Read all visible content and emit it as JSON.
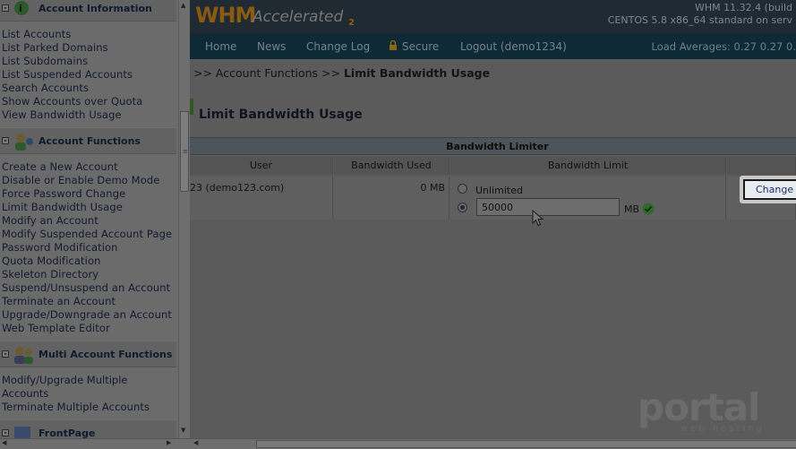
{
  "sidebar": {
    "sections": [
      {
        "title": "Account Information",
        "links": [
          "List Accounts",
          "List Parked Domains",
          "List Subdomains",
          "List Suspended Accounts",
          "Search Accounts",
          "Show Accounts over Quota",
          "View Bandwidth Usage"
        ]
      },
      {
        "title": "Account Functions",
        "links": [
          "Create a New Account",
          "Disable or Enable Demo Mode",
          "Force Password Change",
          "Limit Bandwidth Usage",
          "Modify an Account",
          "Modify Suspended Account Page",
          "Password Modification",
          "Quota Modification",
          "Skeleton Directory",
          "Suspend/Unsuspend an Account",
          "Terminate an Account",
          "Upgrade/Downgrade an Account",
          "Web Template Editor"
        ]
      },
      {
        "title": "Multi Account Functions",
        "links": [
          "Modify/Upgrade Multiple Accounts",
          "Terminate Multiple Accounts"
        ]
      },
      {
        "title": "FrontPage",
        "links": []
      }
    ]
  },
  "header": {
    "logo_whm": "WHM",
    "logo_accelerated": "Accelerated",
    "logo_version": "2",
    "version_line": "WHM 11.32.4 (build",
    "os_line": "CENTOS 5.8 x86_64 standard on serv"
  },
  "nav": {
    "items": [
      "Home",
      "News",
      "Change Log",
      "Secure",
      "Logout (demo1234)"
    ],
    "load_averages": "Load Averages: 0.27 0.27 0."
  },
  "main": {
    "breadcrumb_prefix": ">> Account Functions >> ",
    "breadcrumb_current": "Limit Bandwidth Usage",
    "page_title": "Limit Bandwidth Usage",
    "table": {
      "caption": "Bandwidth Limiter",
      "columns": [
        "User",
        "Bandwidth Used",
        "Bandwidth Limit"
      ],
      "row": {
        "user": "23 (demo123.com)",
        "used": "0 MB",
        "unlimited_label": "Unlimited",
        "limit_value": "50000",
        "unit": "MB",
        "selected_option": "limit"
      },
      "change_button": "Change"
    }
  },
  "watermark": {
    "main": "portal",
    "sub": "web hosting"
  },
  "colors": {
    "topbar": "#1f2a33",
    "navbar": "#0f2a37",
    "overlay_bg": "#5c5c5c",
    "logo_accent": "#8a5a10"
  }
}
